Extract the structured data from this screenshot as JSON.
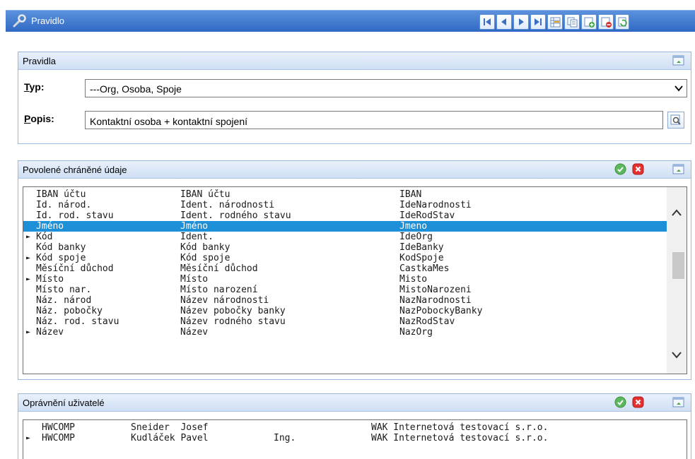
{
  "window": {
    "title": "Pravidlo"
  },
  "toolbar_buttons": [
    {
      "name": "first-record-button",
      "icon": "first-icon"
    },
    {
      "name": "previous-record-button",
      "icon": "previous-icon"
    },
    {
      "name": "next-record-button",
      "icon": "next-icon"
    },
    {
      "name": "last-record-button",
      "icon": "last-icon"
    },
    {
      "name": "grid-view-button",
      "icon": "grid-icon"
    },
    {
      "name": "copy-record-button",
      "icon": "copy-icon"
    },
    {
      "name": "add-record-button",
      "icon": "add-icon"
    },
    {
      "name": "delete-record-button",
      "icon": "delete-icon"
    },
    {
      "name": "refresh-button",
      "icon": "refresh-icon"
    }
  ],
  "rules": {
    "title": "Pravidla",
    "type_label_accel": "T",
    "type_label_rest": "yp:",
    "type_value": "---Org, Osoba, Spoje",
    "desc_label_accel": "P",
    "desc_label_rest": "opis:",
    "desc_value": "Kontaktní osoba + kontaktní spojení"
  },
  "protected": {
    "title": "Povolené chráněné údaje",
    "rows": [
      {
        "marker": "",
        "a": "IBAN účtu",
        "b": "IBAN účtu",
        "c": "IBAN"
      },
      {
        "marker": "",
        "a": "Id. národ.",
        "b": "Ident. národnosti",
        "c": "IdeNarodnosti"
      },
      {
        "marker": "",
        "a": "Id. rod. stavu",
        "b": "Ident. rodného stavu",
        "c": "IdeRodStav"
      },
      {
        "marker": "",
        "a": "Jméno",
        "b": "Jméno",
        "c": "Jmeno",
        "selected": true
      },
      {
        "marker": "►",
        "a": "Kód",
        "b": "Ident.",
        "c": "IdeOrg"
      },
      {
        "marker": "",
        "a": "Kód banky",
        "b": "Kód banky",
        "c": "IdeBanky"
      },
      {
        "marker": "►",
        "a": "Kód spoje",
        "b": "Kód spoje",
        "c": "KodSpoje"
      },
      {
        "marker": "",
        "a": "Měsíční důchod",
        "b": "Měsíční důchod",
        "c": "CastkaMes"
      },
      {
        "marker": "►",
        "a": "Místo",
        "b": "Místo",
        "c": "Misto"
      },
      {
        "marker": "",
        "a": "Místo nar.",
        "b": "Místo narození",
        "c": "MistoNarozeni"
      },
      {
        "marker": "",
        "a": "Náz. národ",
        "b": "Název národnosti",
        "c": "NazNarodnosti"
      },
      {
        "marker": "",
        "a": "Náz. pobočky",
        "b": "Název pobočky banky",
        "c": "NazPobockyBanky"
      },
      {
        "marker": "",
        "a": "Náz. rod. stavu",
        "b": "Název rodného stavu",
        "c": "NazRodStav"
      },
      {
        "marker": "►",
        "a": "Název",
        "b": "Název",
        "c": "NazOrg"
      }
    ]
  },
  "users": {
    "title": "Oprávnění uživatelé",
    "rows": [
      {
        "marker": "",
        "a": "HWCOMP",
        "b": "Sneider  Josef",
        "t": "",
        "c": "WAK Internetová testovací s.r.o."
      },
      {
        "marker": "►",
        "a": "HWCOMP",
        "b": "Kudláček Pavel",
        "t": "Ing.",
        "c": "WAK Internetová testovací s.r.o."
      }
    ]
  },
  "colors": {
    "titlebar": "#3d78cf",
    "selection": "#1e90d8",
    "panel_border": "#9ab8df"
  }
}
